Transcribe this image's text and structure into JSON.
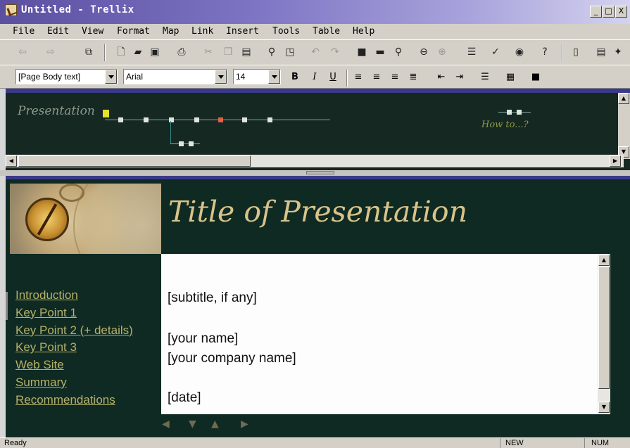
{
  "window": {
    "title": "Untitled - Trellix",
    "buttons": [
      "_",
      "□",
      "X"
    ]
  },
  "menu": [
    "File",
    "Edit",
    "View",
    "Format",
    "Map",
    "Link",
    "Insert",
    "Tools",
    "Table",
    "Help"
  ],
  "toolbar": {
    "icons": [
      "back-icon",
      "forward-icon",
      "link-icon",
      "new-icon",
      "open-icon",
      "save-icon",
      "print-icon",
      "cut-icon",
      "copy-icon",
      "paste-icon",
      "find-icon",
      "spell-icon",
      "undo-icon",
      "redo-icon",
      "map-view-icon",
      "page-view-icon",
      "zoom-icon",
      "hide-icon",
      "show-icon",
      "publish-icon",
      "spell-check-icon",
      "web-icon",
      "whats-this-icon",
      "properties-icon",
      "notes-icon",
      "star-icon"
    ]
  },
  "format": {
    "style": "[Page Body text]",
    "font": "Arial",
    "size": "14",
    "bold": "B",
    "italic": "I",
    "underline": "U"
  },
  "map": {
    "label": "Presentation",
    "howto": "How to...?"
  },
  "page": {
    "title": "Title of Presentation",
    "nav": [
      "Introduction",
      "Key Point 1",
      "Key Point 2 (+ details)",
      "Key Point 3",
      "Web Site",
      "Summary",
      "Recommendations"
    ],
    "body": {
      "subtitle": "[subtitle, if any]",
      "name": "[your name]",
      "company": "[your company name]",
      "date": "[date]"
    }
  },
  "status": {
    "left": "Ready",
    "new": "NEW",
    "num": "NUM"
  }
}
